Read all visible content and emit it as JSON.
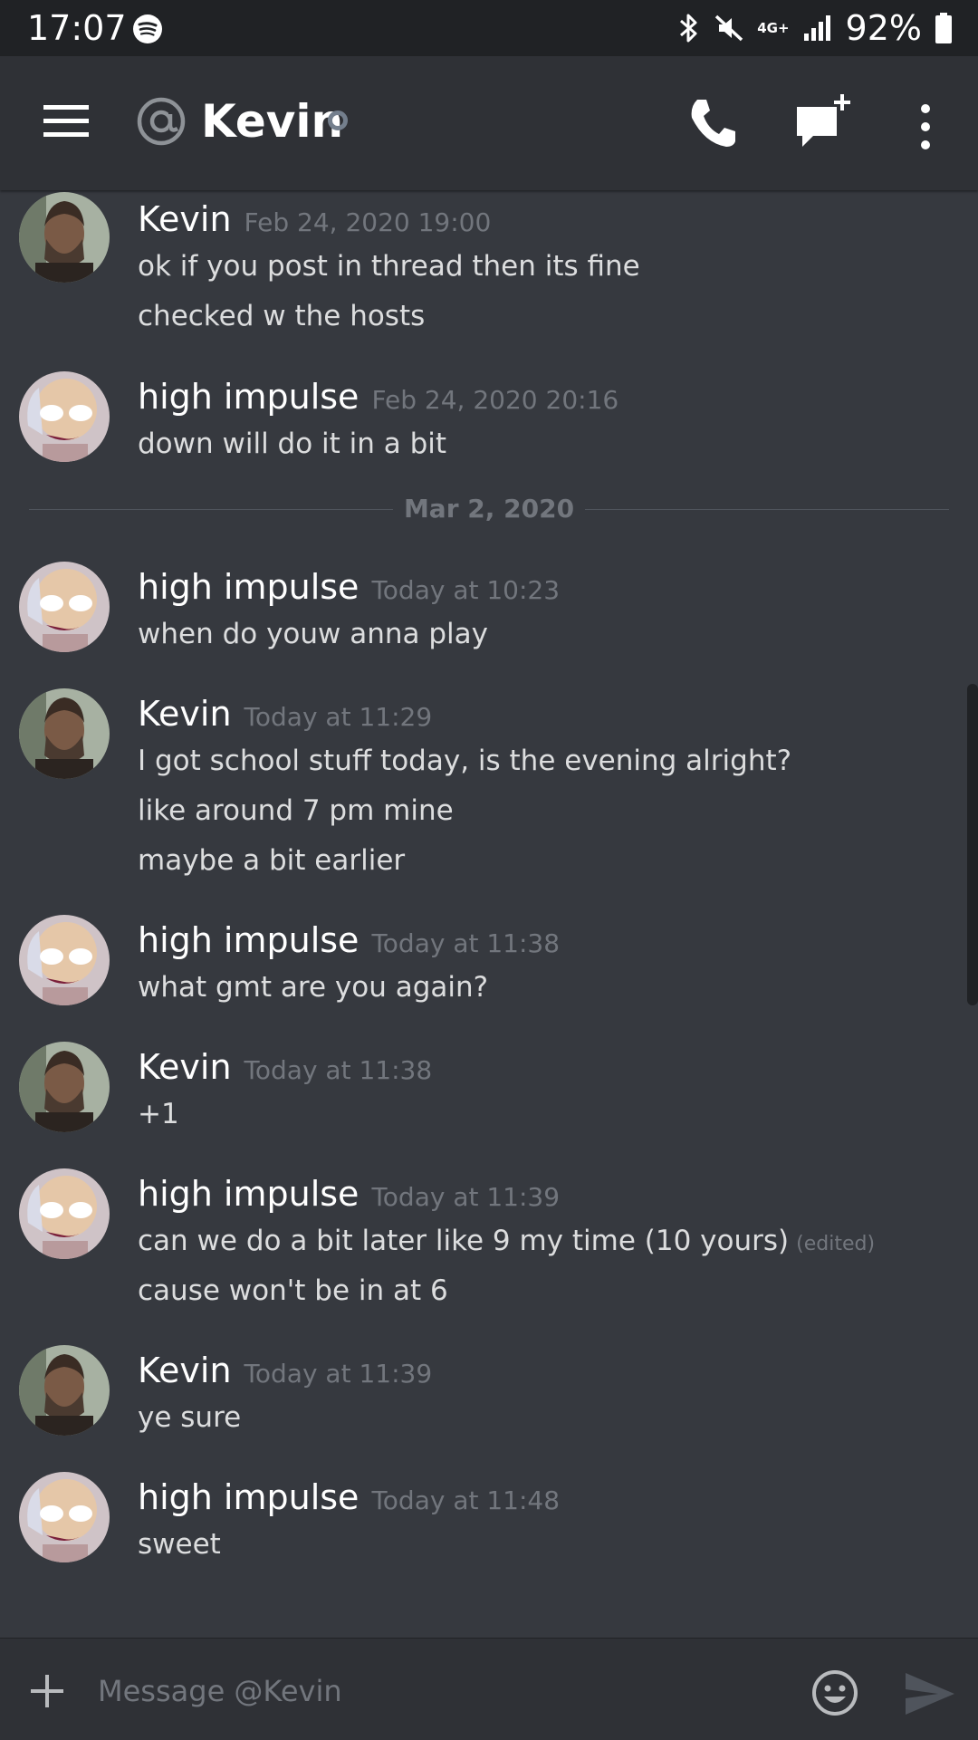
{
  "status_bar": {
    "time": "17:07",
    "network": "4G+",
    "battery": "92%"
  },
  "header": {
    "channel_name": "Kevin",
    "icons": [
      "hamburger-menu-icon",
      "at-sign-icon",
      "status-dot",
      "phone-call-icon",
      "new-group-dm-icon",
      "more-options-icon"
    ]
  },
  "divider": {
    "label": "Mar 2, 2020"
  },
  "messages": [
    {
      "author": "Kevin",
      "timestamp": "Feb 24, 2020 19:00",
      "lines": [
        "ok if you post in thread then its fine",
        "checked w the hosts"
      ]
    },
    {
      "author": "high impulse",
      "timestamp": "Feb 24, 2020 20:16",
      "lines": [
        "down will do it in a bit"
      ]
    },
    {
      "author": "high impulse",
      "timestamp": "Today at 10:23",
      "lines": [
        "when do youw anna play"
      ]
    },
    {
      "author": "Kevin",
      "timestamp": "Today at 11:29",
      "lines": [
        "I got school stuff today, is the evening alright?",
        "like around 7 pm mine",
        "maybe a bit earlier"
      ]
    },
    {
      "author": "high impulse",
      "timestamp": "Today at 11:38",
      "lines": [
        "what gmt are you again?"
      ]
    },
    {
      "author": "Kevin",
      "timestamp": "Today at 11:38",
      "lines": [
        "+1"
      ]
    },
    {
      "author": "high impulse",
      "timestamp": "Today at 11:39",
      "lines": [
        "can we do a bit later like 9 my time (10 yours)",
        "cause won't be in at 6"
      ],
      "edited_label": "(edited)"
    },
    {
      "author": "Kevin",
      "timestamp": "Today at 11:39",
      "lines": [
        "ye sure"
      ]
    },
    {
      "author": "high impulse",
      "timestamp": "Today at 11:48",
      "lines": [
        "sweet"
      ]
    }
  ],
  "composer": {
    "placeholder": "Message @Kevin"
  },
  "colors": {
    "background": "#36393f",
    "header": "#2f3136",
    "statusbar": "#202225",
    "timestamp": "#72767d"
  }
}
